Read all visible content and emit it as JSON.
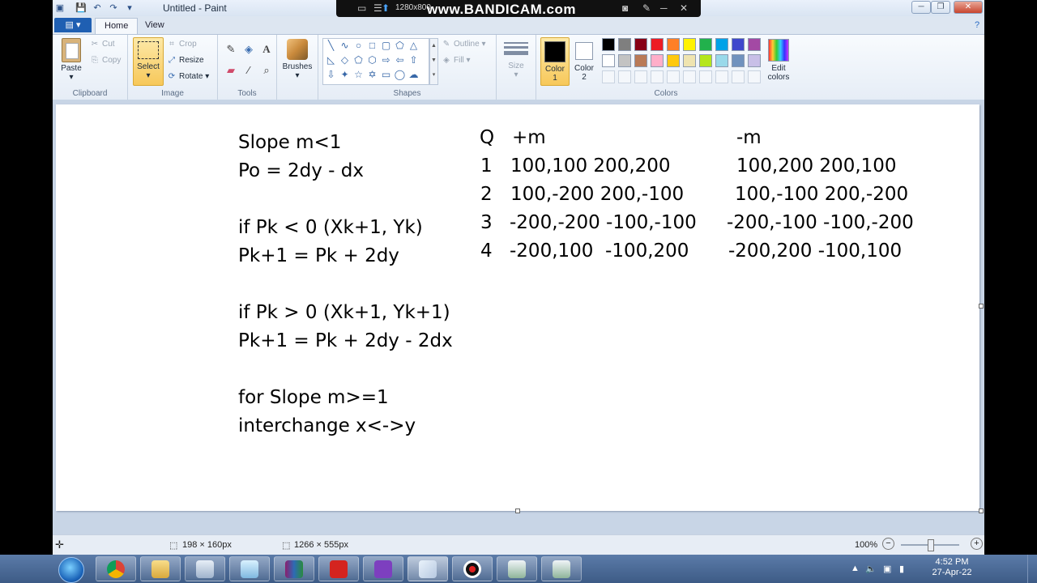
{
  "window": {
    "title": "Untitled - Paint"
  },
  "recorder": {
    "resolution": "1280x800",
    "brand": "www.BANDICAM.com"
  },
  "ribbon": {
    "tabs": [
      "Home",
      "View"
    ],
    "clipboard": {
      "paste": "Paste",
      "cut": "Cut",
      "copy": "Copy",
      "label": "Clipboard"
    },
    "image": {
      "select": "Select",
      "crop": "Crop",
      "resize": "Resize",
      "rotate": "Rotate",
      "label": "Image"
    },
    "tools": {
      "label": "Tools"
    },
    "brushes": {
      "label": "Brushes"
    },
    "shapes": {
      "outline": "Outline",
      "fill": "Fill",
      "label": "Shapes"
    },
    "size": {
      "label": "Size"
    },
    "colors": {
      "color1_line1": "Color",
      "color1_line2": "1",
      "color2_line1": "Color",
      "color2_line2": "2",
      "edit_line1": "Edit",
      "edit_line2": "colors",
      "label": "Colors",
      "palette_row1": [
        "#000000",
        "#7f7f7f",
        "#880015",
        "#ed1c24",
        "#ff7f27",
        "#fff200",
        "#22b14c",
        "#00a2e8",
        "#3f48cc",
        "#a349a4"
      ],
      "palette_row2": [
        "#ffffff",
        "#c3c3c3",
        "#b97a57",
        "#ffaec9",
        "#ffc90e",
        "#efe4b0",
        "#b5e61d",
        "#99d9ea",
        "#7092be",
        "#c8bfe7"
      ]
    }
  },
  "canvas": {
    "left_lines": [
      "Slope m<1",
      "Po = 2dy - dx",
      "if Pk < 0 (Xk+1, Yk)",
      "Pk+1 = Pk + 2dy",
      "if Pk > 0 (Xk+1, Yk+1)",
      "Pk+1 = Pk + 2dy - 2dx",
      "for Slope m>=1",
      "interchange x<->y"
    ],
    "table": {
      "headers": [
        "Q",
        "+m",
        "-m"
      ],
      "rows": [
        {
          "q": "1",
          "plus": "100,100 200,200",
          "minus": "100,200 200,100"
        },
        {
          "q": "2",
          "plus": "100,-200 200,-100",
          "minus": "100,-100 200,-200"
        },
        {
          "q": "3",
          "plus": "-200,-200 -100,-100",
          "minus": "-200,-100 -100,-200"
        },
        {
          "q": "4",
          "plus": "-200,100  -100,200",
          "minus": "-200,200 -100,100"
        }
      ]
    }
  },
  "status": {
    "selection_size": "198 × 160px",
    "canvas_size": "1266 × 555px",
    "zoom": "100%"
  },
  "taskbar": {
    "time": "4:52 PM",
    "date": "27-Apr-22"
  }
}
